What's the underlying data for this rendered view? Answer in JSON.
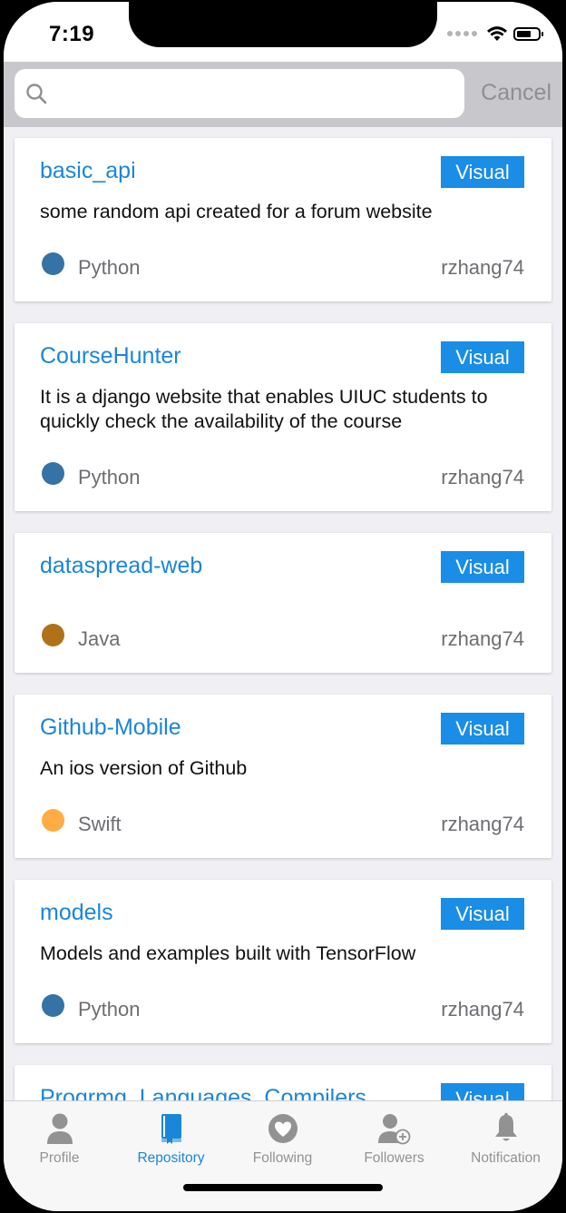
{
  "status": {
    "time": "7:19"
  },
  "search": {
    "placeholder": "",
    "cancel_label": "Cancel"
  },
  "visual_label": "Visual",
  "repos": [
    {
      "name": "basic_api",
      "description": "some random api created for a forum website",
      "language": "Python",
      "language_color": "#3572A5",
      "owner": "rzhang74"
    },
    {
      "name": "CourseHunter",
      "description": "It is a django website that enables UIUC students to quickly check the availability of the course",
      "language": "Python",
      "language_color": "#3572A5",
      "owner": "rzhang74"
    },
    {
      "name": "dataspread-web",
      "description": "",
      "language": "Java",
      "language_color": "#b07219",
      "owner": "rzhang74"
    },
    {
      "name": "Github-Mobile",
      "description": "An ios version of Github",
      "language": "Swift",
      "language_color": "#ffac45",
      "owner": "rzhang74"
    },
    {
      "name": "models",
      "description": "Models and examples built with TensorFlow",
      "language": "Python",
      "language_color": "#3572A5",
      "owner": "rzhang74"
    },
    {
      "name": "Progrmg_Languages_Compilers",
      "description": "",
      "language": "",
      "language_color": "",
      "owner": ""
    }
  ],
  "tabs": [
    {
      "label": "Profile",
      "icon": "person-icon",
      "active": false
    },
    {
      "label": "Repository",
      "icon": "book-icon",
      "active": true
    },
    {
      "label": "Following",
      "icon": "heart-icon",
      "active": false
    },
    {
      "label": "Followers",
      "icon": "person-add-icon",
      "active": false
    },
    {
      "label": "Notification",
      "icon": "bell-icon",
      "active": false
    }
  ],
  "colors": {
    "accent": "#1a86d9",
    "inactive": "#929292"
  }
}
